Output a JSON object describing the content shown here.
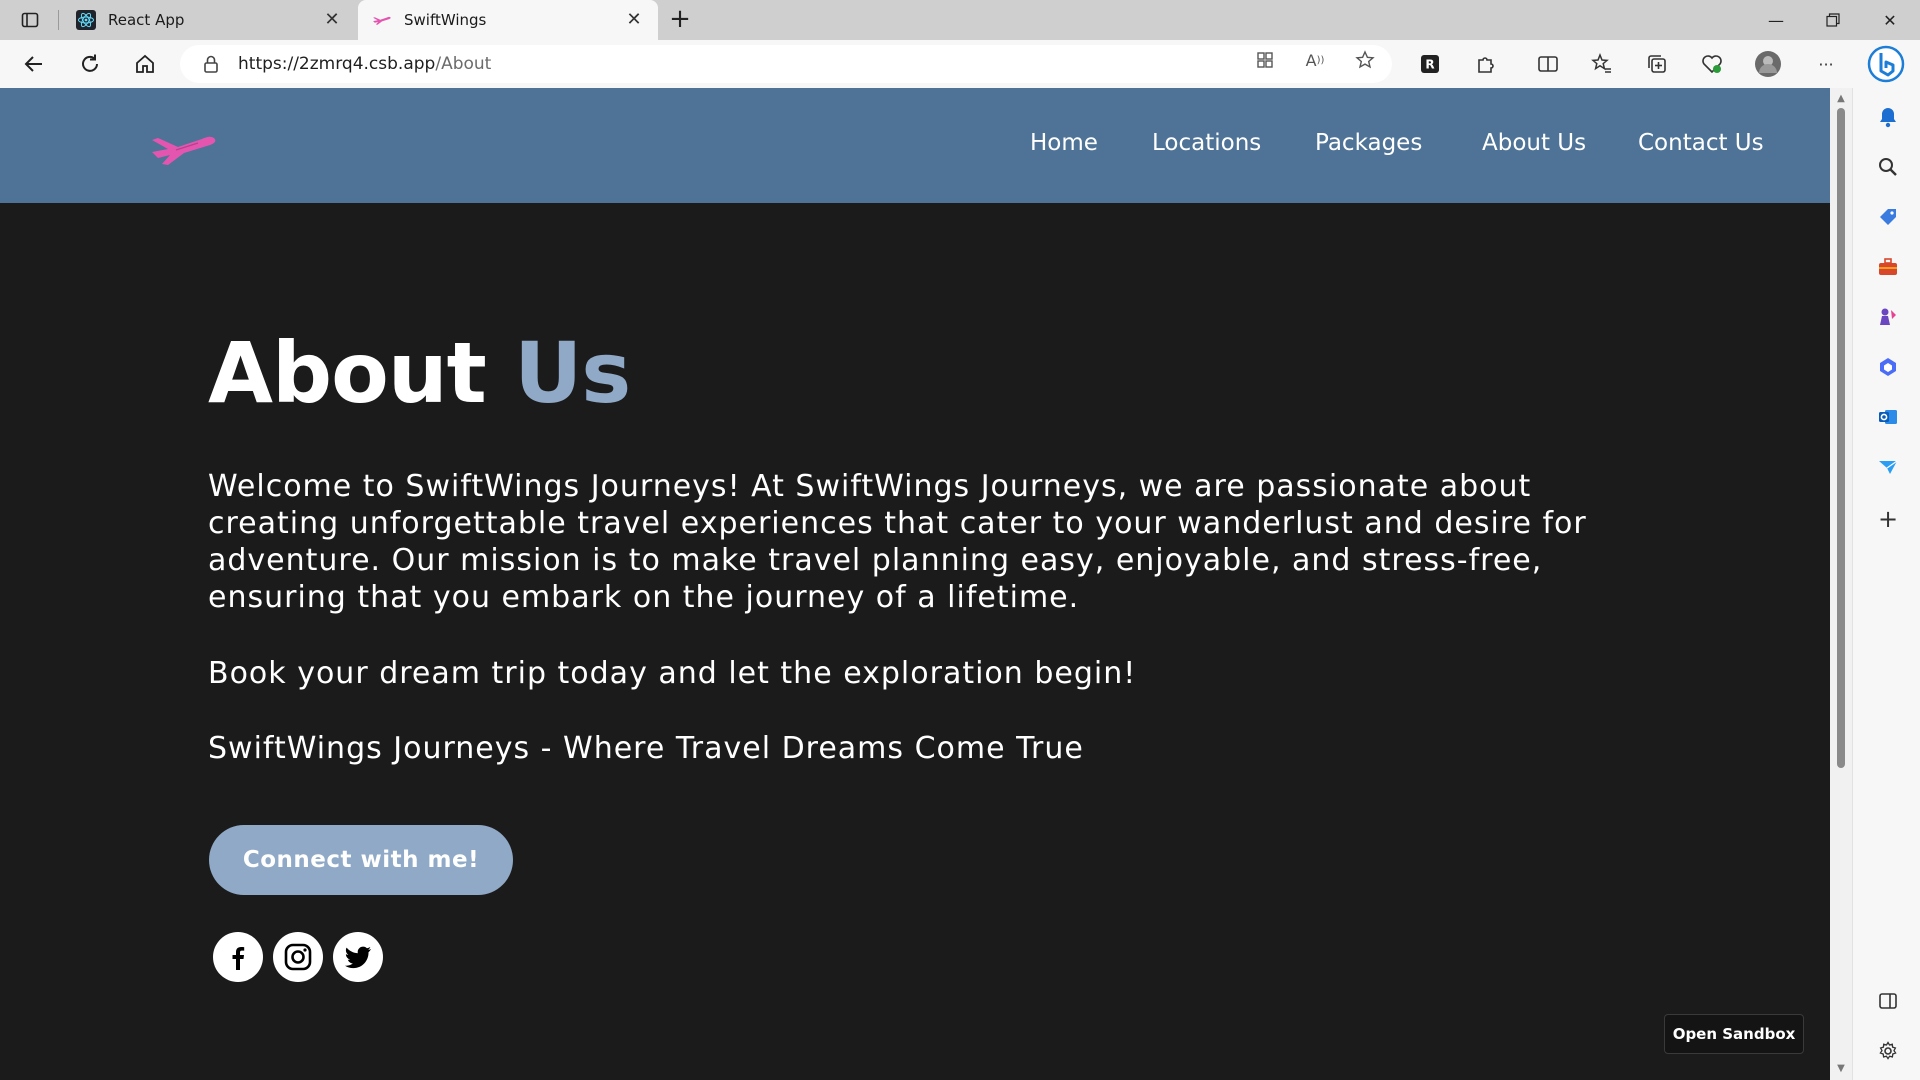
{
  "browser": {
    "tabs": [
      {
        "title": "React App",
        "active": false
      },
      {
        "title": "SwiftWings",
        "active": true
      }
    ],
    "url_host": "https://2zmrq4.csb.app",
    "url_path": "/About"
  },
  "site": {
    "nav": [
      {
        "label": "Home"
      },
      {
        "label": "Locations"
      },
      {
        "label": "Packages"
      },
      {
        "label": "About Us"
      },
      {
        "label": "Contact Us"
      }
    ],
    "title_main": "About",
    "title_accent": "Us",
    "paragraphs": [
      "Welcome to SwiftWings Journeys! At SwiftWings Journeys, we are passionate about creating unforgettable travel experiences that cater to your wanderlust and desire for adventure. Our mission is to make travel planning easy, enjoyable, and stress-free, ensuring that you embark on the journey of a lifetime.",
      "Book your dream trip today and let the exploration begin!",
      "SwiftWings Journeys - Where Travel Dreams Come True"
    ],
    "cta_label": "Connect with me!",
    "socials": [
      "facebook-icon",
      "instagram-icon",
      "twitter-icon"
    ],
    "sandbox_label": "Open Sandbox"
  },
  "colors": {
    "nav_bg": "#4e7397",
    "page_bg": "#1b1b1b",
    "accent": "#8fa9c6",
    "logo_pink": "#e455b0"
  }
}
